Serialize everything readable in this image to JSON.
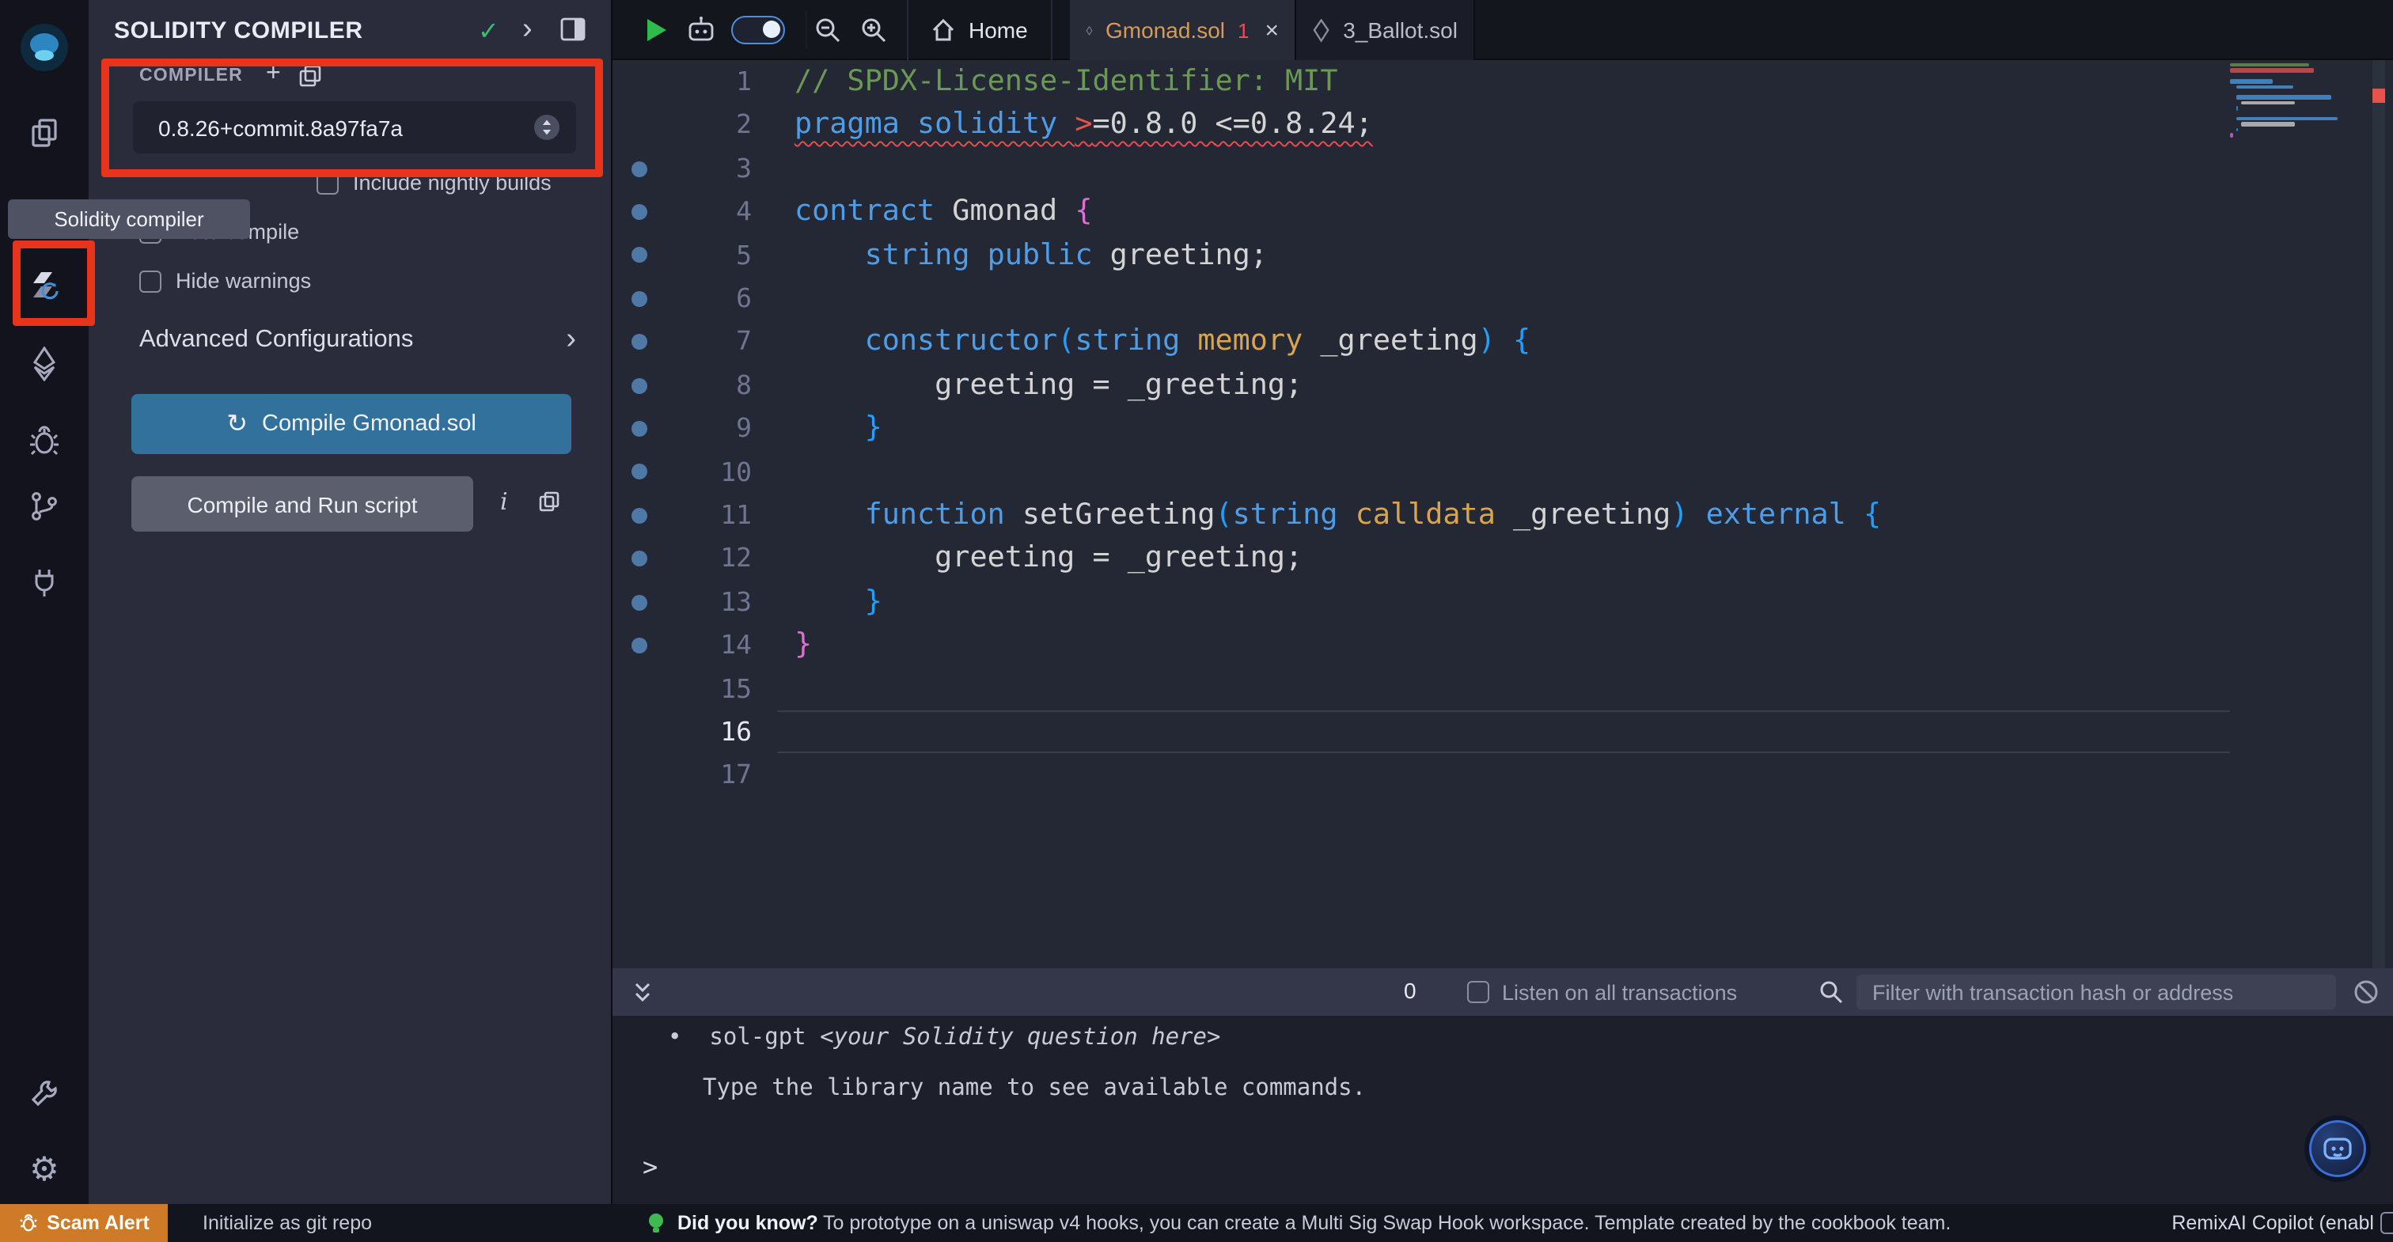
{
  "icons": {
    "check": "✓",
    "chevron_right": "›",
    "plus": "+",
    "refresh": "↻",
    "close": "×",
    "gear": "⚙",
    "bullet": "•",
    "info": "i"
  },
  "tooltip_label": "Solidity compiler",
  "side_panel": {
    "title": "SOLIDITY COMPILER",
    "section_label": "COMPILER",
    "version_selected": "0.8.26+commit.8a97fa7a",
    "include_nightly_label": "Include nightly builds",
    "auto_compile_label": "Auto compile",
    "hide_warnings_label": "Hide warnings",
    "advanced_label": "Advanced Configurations",
    "compile_button_label": "Compile Gmonad.sol",
    "run_script_button_label": "Compile and Run script"
  },
  "editor": {
    "home_tab": "Home",
    "tabs": [
      {
        "label": "Gmonad.sol",
        "badge": "1",
        "active": true
      },
      {
        "label": "3_Ballot.sol",
        "badge": "",
        "active": false
      }
    ],
    "current_line": 16,
    "breakpoint_lines": [
      3,
      4,
      5,
      6,
      7,
      8,
      9,
      10,
      11,
      12,
      13,
      14
    ],
    "syntax_colors": {
      "comment": "#6A9955",
      "keyword": "#4E9DE6",
      "plain": "#D4D4D4",
      "datalocation": "#D9A44C",
      "error": "#E5534B",
      "bracket1": "#DA70D6",
      "bracket2": "#1FA0FF"
    },
    "code_lines": [
      {
        "n": 1,
        "tokens": [
          {
            "t": "// SPDX-License-Identifier: MIT",
            "c": "comment"
          }
        ]
      },
      {
        "n": 2,
        "squiggle": true,
        "tokens": [
          {
            "t": "pragma solidity ",
            "c": "keyword"
          },
          {
            "t": ">",
            "c": "error"
          },
          {
            "t": "=0.8.0 ",
            "c": "plain"
          },
          {
            "t": "<=0.8.24;",
            "c": "plain"
          }
        ]
      },
      {
        "n": 3,
        "tokens": []
      },
      {
        "n": 4,
        "tokens": [
          {
            "t": "contract",
            "c": "keyword"
          },
          {
            "t": " Gmonad ",
            "c": "plain"
          },
          {
            "t": "{",
            "c": "bracket1"
          }
        ]
      },
      {
        "n": 5,
        "tokens": [
          {
            "t": "    ",
            "c": "plain"
          },
          {
            "t": "string",
            "c": "keyword"
          },
          {
            "t": " ",
            "c": "plain"
          },
          {
            "t": "public",
            "c": "keyword"
          },
          {
            "t": " greeting;",
            "c": "plain"
          }
        ]
      },
      {
        "n": 6,
        "tokens": []
      },
      {
        "n": 7,
        "tokens": [
          {
            "t": "    ",
            "c": "plain"
          },
          {
            "t": "constructor",
            "c": "keyword"
          },
          {
            "t": "(",
            "c": "bracket2"
          },
          {
            "t": "string",
            "c": "keyword"
          },
          {
            "t": " ",
            "c": "plain"
          },
          {
            "t": "memory",
            "c": "datalocation"
          },
          {
            "t": " _greeting",
            "c": "plain"
          },
          {
            "t": ")",
            "c": "bracket2"
          },
          {
            "t": " ",
            "c": "plain"
          },
          {
            "t": "{",
            "c": "bracket2"
          }
        ]
      },
      {
        "n": 8,
        "tokens": [
          {
            "t": "        greeting = _greeting;",
            "c": "plain"
          }
        ]
      },
      {
        "n": 9,
        "tokens": [
          {
            "t": "    ",
            "c": "plain"
          },
          {
            "t": "}",
            "c": "bracket2"
          }
        ]
      },
      {
        "n": 10,
        "tokens": []
      },
      {
        "n": 11,
        "tokens": [
          {
            "t": "    ",
            "c": "plain"
          },
          {
            "t": "function",
            "c": "keyword"
          },
          {
            "t": " setGreeting",
            "c": "plain"
          },
          {
            "t": "(",
            "c": "bracket2"
          },
          {
            "t": "string",
            "c": "keyword"
          },
          {
            "t": " ",
            "c": "plain"
          },
          {
            "t": "calldata",
            "c": "datalocation"
          },
          {
            "t": " _greeting",
            "c": "plain"
          },
          {
            "t": ")",
            "c": "bracket2"
          },
          {
            "t": " ",
            "c": "plain"
          },
          {
            "t": "external",
            "c": "keyword"
          },
          {
            "t": " ",
            "c": "plain"
          },
          {
            "t": "{",
            "c": "bracket2"
          }
        ]
      },
      {
        "n": 12,
        "tokens": [
          {
            "t": "        greeting = _greeting;",
            "c": "plain"
          }
        ]
      },
      {
        "n": 13,
        "tokens": [
          {
            "t": "    ",
            "c": "plain"
          },
          {
            "t": "}",
            "c": "bracket2"
          }
        ]
      },
      {
        "n": 14,
        "tokens": [
          {
            "t": "}",
            "c": "bracket1"
          }
        ]
      },
      {
        "n": 15,
        "tokens": []
      },
      {
        "n": 16,
        "tokens": []
      },
      {
        "n": 17,
        "tokens": []
      }
    ]
  },
  "terminal": {
    "tx_count": "0",
    "listen_label": "Listen on all transactions",
    "filter_placeholder": "Filter with transaction hash or address",
    "line1_cmd": "sol-gpt ",
    "line1_hint": "<your Solidity question here>",
    "line2": "Type the library name to see available commands.",
    "prompt": ">"
  },
  "status_bar": {
    "scam_alert": "Scam Alert",
    "git_init": "Initialize as git repo",
    "tip_title": "Did you know?",
    "tip_body": "To prototype on a uniswap v4 hooks, you can create a Multi Sig Swap Hook workspace. Template created by the cookbook team.",
    "copilot": "RemixAI Copilot (enabl"
  },
  "annotations": {
    "highlight_color": "#E8341C"
  }
}
